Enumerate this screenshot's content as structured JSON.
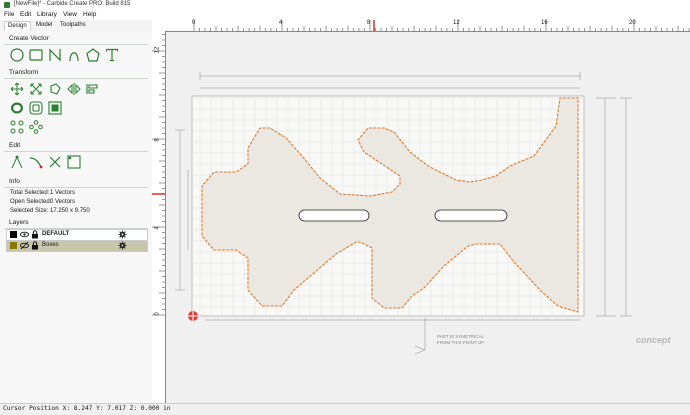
{
  "window": {
    "title": "[NewFile]* - Carbide Create PRO: Build 815"
  },
  "menu": [
    {
      "label": "File",
      "underline": "F"
    },
    {
      "label": "Edit",
      "underline": "E"
    },
    {
      "label": "Library",
      "underline": "L"
    },
    {
      "label": "View",
      "underline": "V"
    },
    {
      "label": "Help",
      "underline": "H"
    }
  ],
  "tabs": [
    "Design",
    "Model",
    "Toolpaths"
  ],
  "create_vector": {
    "header": "Create Vector",
    "tools": [
      "circle-tool-icon",
      "rectangle-tool-icon",
      "polyline-tool-icon",
      "curve-tool-icon",
      "polygon-tool-icon",
      "text-tool-icon"
    ]
  },
  "transform": {
    "header": "Transform",
    "tools": [
      "move-icon",
      "scale-icon",
      "rotate-icon",
      "mirror-icon",
      "align-icon",
      "offset-icon",
      "outline-icon",
      "fillet-icon",
      "array-icon",
      "circular-array-icon"
    ]
  },
  "edit": {
    "header": "Edit",
    "tools": [
      "node-edit-icon",
      "join-icon",
      "trim-icon",
      "boolean-icon"
    ]
  },
  "info": {
    "header": "Info",
    "total_selected_label": "Total Selected:",
    "total_selected_value": "1 Vectors",
    "open_selected_label": "Open Selected:",
    "open_selected_value": "0 Vectors",
    "selected_size_label": "Selected Size:",
    "selected_size_value": "17.250 x 9.750"
  },
  "layers": {
    "header": "Layers",
    "items": [
      {
        "name": "DEFAULT",
        "color": "#000000",
        "selected": false
      },
      {
        "name": "Boxes",
        "color": "#8a7a00",
        "selected": true
      }
    ]
  },
  "rulers": {
    "h_labels": [
      "0",
      "4",
      "8",
      "12",
      "16",
      "20"
    ],
    "v_labels": [
      "12",
      "8",
      "4",
      "0"
    ]
  },
  "drawing": {
    "note_line1": "PART IS SYMETRICAL",
    "note_line2": "FROM THIS POINT UP",
    "watermark": "concept"
  },
  "status": {
    "text": "Cursor Position X: 8.247 Y: 7.017 Z: 0.000 in"
  },
  "colors": {
    "accent": "#2e7d32",
    "part_fill": "#ebe8e1",
    "part_outline": "#e07a2e",
    "ruler_marker": "#e53935"
  }
}
